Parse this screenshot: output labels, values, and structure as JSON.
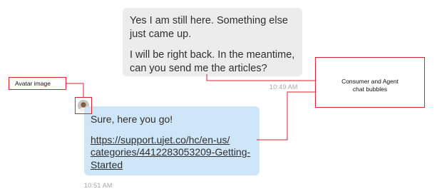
{
  "conversation": {
    "consumer_message": {
      "paragraphs": [
        "Yes I am still here. Something else just came up.",
        "I will be right back. In the meantime, can you send me the articles?"
      ],
      "timestamp": "10:49 AM"
    },
    "agent_message": {
      "text": "Sure, here you go!",
      "link": "https://support.ujet.co/hc/en-us/categories/4412283053209-Getting-Started",
      "link_lines": [
        "https://support.ujet.co/hc/en-us/",
        "categories/4412283053209-Getting-",
        "Started"
      ],
      "timestamp": "10:51 AM"
    }
  },
  "annotations": {
    "avatar_label": "Avatar image",
    "bubbles_label_line1": "Consumer and Agent",
    "bubbles_label_line2": "chat bubbles"
  },
  "colors": {
    "consumer_bubble": "#ececec",
    "agent_bubble": "#cfe5f8",
    "annotation_red": "#d9262c",
    "timestamp": "#a6a6a6"
  },
  "icons": {
    "avatar": "agent-avatar-photo"
  }
}
